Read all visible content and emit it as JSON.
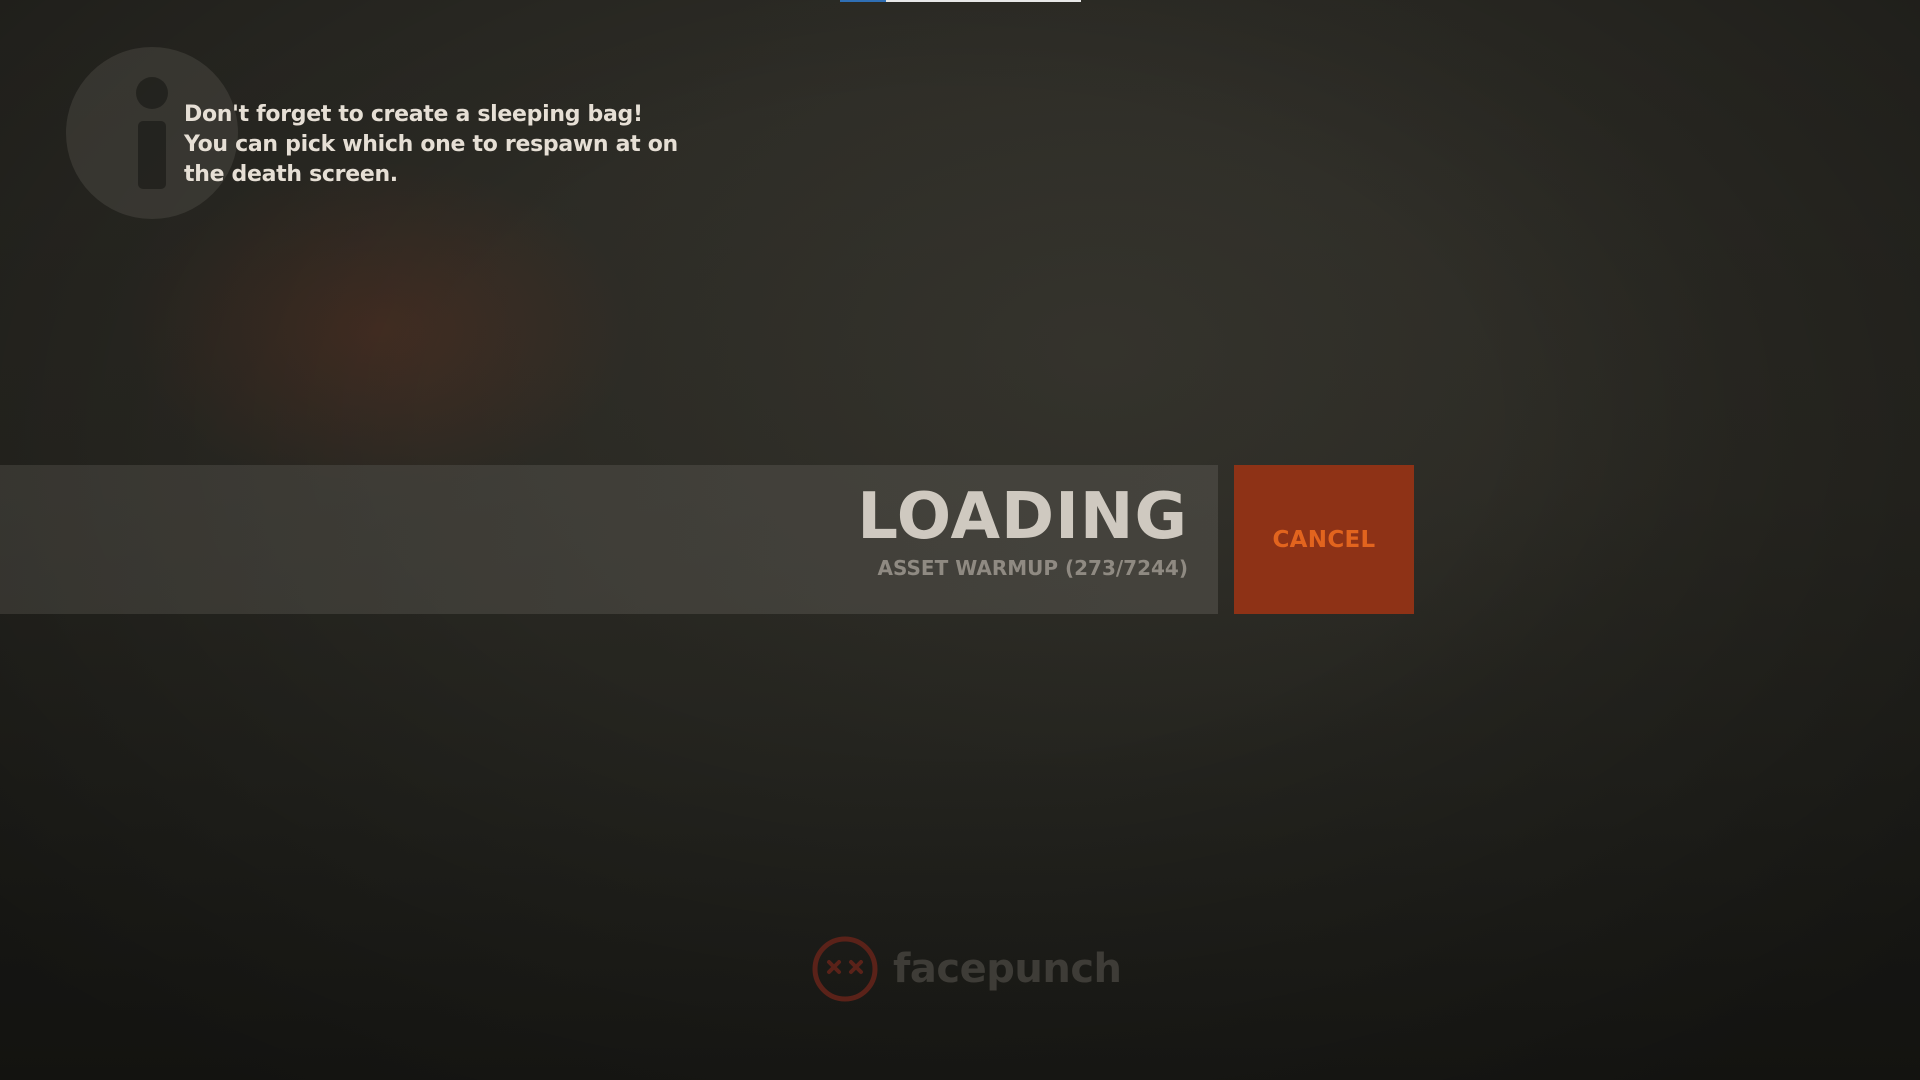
{
  "top_progress": {
    "fraction": 0.19,
    "fill_color": "#2f6fb5",
    "track_color": "#e8e8e8"
  },
  "hint": {
    "icon": "info-icon",
    "text": "Don't forget to create a sleeping bag! You can pick which one to respawn at on the death screen."
  },
  "loading": {
    "title": "LOADING",
    "status": "ASSET WARMUP (273/7244)"
  },
  "cancel": {
    "label": "CANCEL",
    "background_color": "#8e3216",
    "text_color": "#e2641e"
  },
  "footer": {
    "logo_text": "facepunch",
    "logo_icon": "facepunch-logo-icon"
  }
}
